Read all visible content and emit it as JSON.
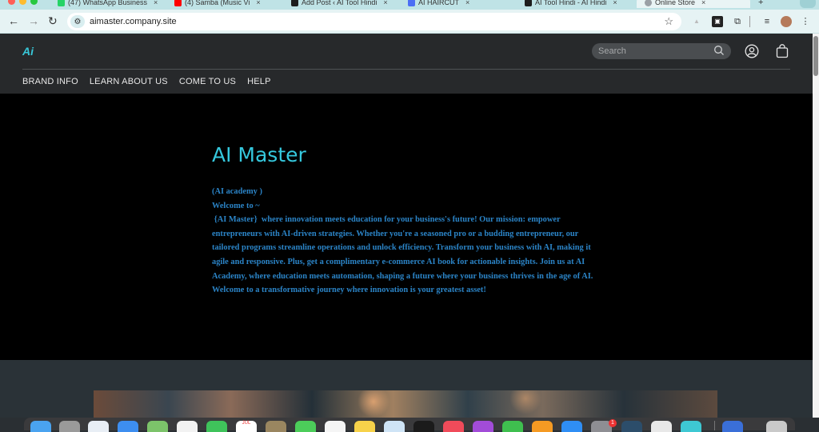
{
  "browser": {
    "tabs": [
      {
        "label": "(47) WhatsApp Business",
        "color": "#25d366"
      },
      {
        "label": "(4) Samba (Music Vi",
        "color": "#ff0000"
      },
      {
        "label": "Add Post ‹ AI Tool Hindi",
        "color": "#1d1d1d"
      },
      {
        "label": "AI HAIRCUT",
        "color": "#4c6ef5"
      },
      {
        "label": "AI Tool Hindi - AI Hindi",
        "color": "#1d1d1d"
      },
      {
        "label": "Online Store",
        "color": "#9aa0a6"
      }
    ],
    "url": "aimaster.company.site",
    "icons": [
      "back-arrow-icon",
      "forward-arrow-icon",
      "reload-icon",
      "site-settings-icon",
      "bookmark-star-icon",
      "extensions-icon",
      "media-controls-icon",
      "profile-avatar-icon",
      "more-menu-icon"
    ]
  },
  "site": {
    "logo": "Ai",
    "search_placeholder": "Search",
    "nav": [
      "BRAND INFO",
      "LEARN ABOUT US",
      "COME TO US",
      "HELP"
    ],
    "hero": {
      "title": "AI Master",
      "line1": "(AI academy )",
      "line2": "Welcome to  ~",
      "paragraph": " {AI Master}  where innovation meets education for your business's future! Our mission: empower entrepreneurs with AI-driven strategies. Whether you're a seasoned pro or a budding entrepreneur, our tailored programs streamline operations and unlock efficiency. Transform your business with AI, making it agile and responsive. Plus, get a complimentary e-commerce AI book for actionable insights. Join us at AI Academy, where education meets automation, shaping a future where your business thrives in the age of AI. Welcome to a transformative journey where innovation is your greatest asset!"
    },
    "colors": {
      "accent": "#35c8dd",
      "body_text": "#2b84c7",
      "header_bg": "#27292b",
      "hero_bg": "#000000"
    }
  },
  "dock": {
    "apps": [
      "finder-icon",
      "launchpad-icon",
      "safari-icon",
      "mail-icon",
      "maps-icon",
      "photos-icon",
      "facetime-icon",
      "calendar-icon",
      "notes-icon",
      "messages-icon",
      "reminders-icon",
      "stickies-icon",
      "preview-icon",
      "tv-icon",
      "music-icon",
      "podcasts-icon",
      "numbers-icon",
      "pages-icon",
      "app-store-icon",
      "system-settings-icon",
      "screen-sharing-icon",
      "chrome-icon",
      "app-icon",
      "downloads-icon",
      "trash-icon"
    ],
    "badge": "1",
    "calendar_month": "JUL"
  }
}
